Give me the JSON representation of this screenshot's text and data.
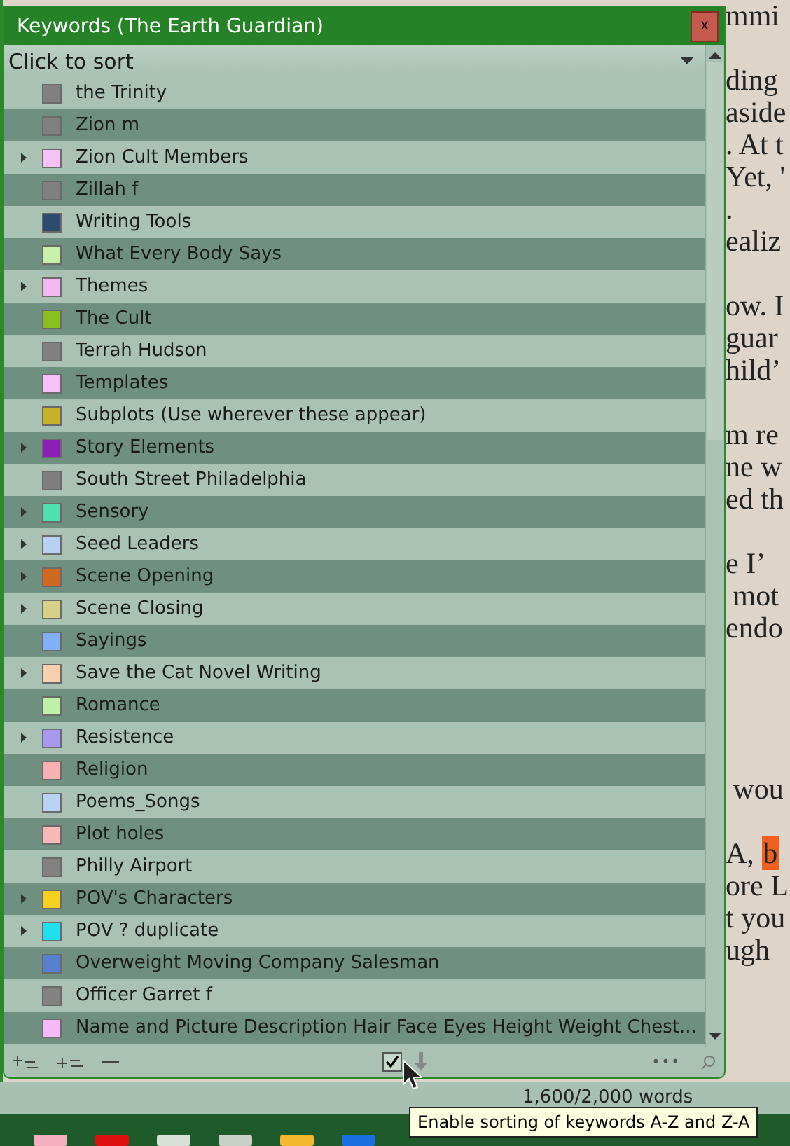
{
  "window": {
    "title": "Keywords (The Earth Guardian)",
    "close": "x"
  },
  "sort_header": {
    "label": "Click to sort"
  },
  "keywords": [
    {
      "label": "the Trinity",
      "color": "#808080",
      "expandable": false
    },
    {
      "label": "Zion m",
      "color": "#808080",
      "expandable": false
    },
    {
      "label": "Zion Cult Members",
      "color": "#f6c2f6",
      "expandable": true
    },
    {
      "label": "Zillah f",
      "color": "#808080",
      "expandable": false
    },
    {
      "label": "Writing Tools",
      "color": "#2e4a6e",
      "expandable": false
    },
    {
      "label": "What Every Body Says",
      "color": "#c8f0a8",
      "expandable": false
    },
    {
      "label": "Themes",
      "color": "#f4b8f0",
      "expandable": true
    },
    {
      "label": "The Cult",
      "color": "#88c020",
      "expandable": false
    },
    {
      "label": "Terrah Hudson",
      "color": "#808080",
      "expandable": false
    },
    {
      "label": "Templates",
      "color": "#f8c0f8",
      "expandable": false
    },
    {
      "label": "Subplots (Use wherever these appear)",
      "color": "#c8b028",
      "expandable": false
    },
    {
      "label": "Story Elements",
      "color": "#8a20b8",
      "expandable": true
    },
    {
      "label": "South Street Philadelphia",
      "color": "#7f7f7f",
      "expandable": false
    },
    {
      "label": "Sensory",
      "color": "#50e0b0",
      "expandable": true
    },
    {
      "label": "Seed Leaders",
      "color": "#b8d0f4",
      "expandable": true
    },
    {
      "label": "Scene Opening",
      "color": "#d06820",
      "expandable": true
    },
    {
      "label": "Scene Closing",
      "color": "#d8d088",
      "expandable": true
    },
    {
      "label": "Sayings",
      "color": "#80b0f8",
      "expandable": false
    },
    {
      "label": "Save the Cat Novel Writing",
      "color": "#f8d0b0",
      "expandable": true
    },
    {
      "label": "Romance",
      "color": "#c0f0a8",
      "expandable": false
    },
    {
      "label": "Resistence",
      "color": "#a898f0",
      "expandable": true
    },
    {
      "label": "Religion",
      "color": "#f8b0b0",
      "expandable": false
    },
    {
      "label": "Poems_Songs",
      "color": "#b9d1f5",
      "expandable": false
    },
    {
      "label": "Plot holes",
      "color": "#f8b8b8",
      "expandable": false
    },
    {
      "label": "Philly Airport",
      "color": "#818181",
      "expandable": false
    },
    {
      "label": "POV's Characters",
      "color": "#f8d020",
      "expandable": true
    },
    {
      "label": "POV ? duplicate",
      "color": "#20e0f0",
      "expandable": true
    },
    {
      "label": "Overweight Moving Company Salesman",
      "color": "#5880d0",
      "expandable": false
    },
    {
      "label": "Officer Garret f",
      "color": "#828282",
      "expandable": false
    },
    {
      "label": "Name and Picture Description Hair Face Eyes Height Weight Chest...",
      "color": "#f8b9f8",
      "expandable": false
    }
  ],
  "footer": {
    "sort_enabled": true,
    "more": "•••"
  },
  "document_lines": [
    {
      "kind": "text",
      "text": "mmi"
    },
    {
      "kind": "blank"
    },
    {
      "kind": "text",
      "text": "ding"
    },
    {
      "kind": "text",
      "text": "aside"
    },
    {
      "kind": "text",
      "text": ". At t"
    },
    {
      "kind": "text",
      "text": "Yet, '"
    },
    {
      "kind": "text",
      "text": "."
    },
    {
      "kind": "text",
      "text": "ealiz"
    },
    {
      "kind": "blank"
    },
    {
      "kind": "text",
      "text": "ow. I"
    },
    {
      "kind": "text",
      "text": "guar"
    },
    {
      "kind": "text",
      "text": "hild’"
    },
    {
      "kind": "blank"
    },
    {
      "kind": "text",
      "text": "m re"
    },
    {
      "kind": "text",
      "text": "ne w"
    },
    {
      "kind": "text",
      "text": "ed th"
    },
    {
      "kind": "blank"
    },
    {
      "kind": "text",
      "text": "e I’"
    },
    {
      "kind": "text",
      "text": " mot"
    },
    {
      "kind": "text",
      "text": "endo"
    },
    {
      "kind": "blank"
    },
    {
      "kind": "blank"
    },
    {
      "kind": "blank"
    },
    {
      "kind": "blank"
    },
    {
      "kind": "text",
      "text": " wou"
    },
    {
      "kind": "blank"
    },
    {
      "kind": "text",
      "text": "A, ",
      "highlight": "b"
    },
    {
      "kind": "text",
      "text": "ore L"
    },
    {
      "kind": "text",
      "text": "t you"
    },
    {
      "kind": "text",
      "text": "ugh"
    }
  ],
  "status": {
    "word_count": "1,600/2,000 words"
  },
  "tooltip": {
    "text": "Enable sorting of keywords A-Z and Z-A"
  }
}
